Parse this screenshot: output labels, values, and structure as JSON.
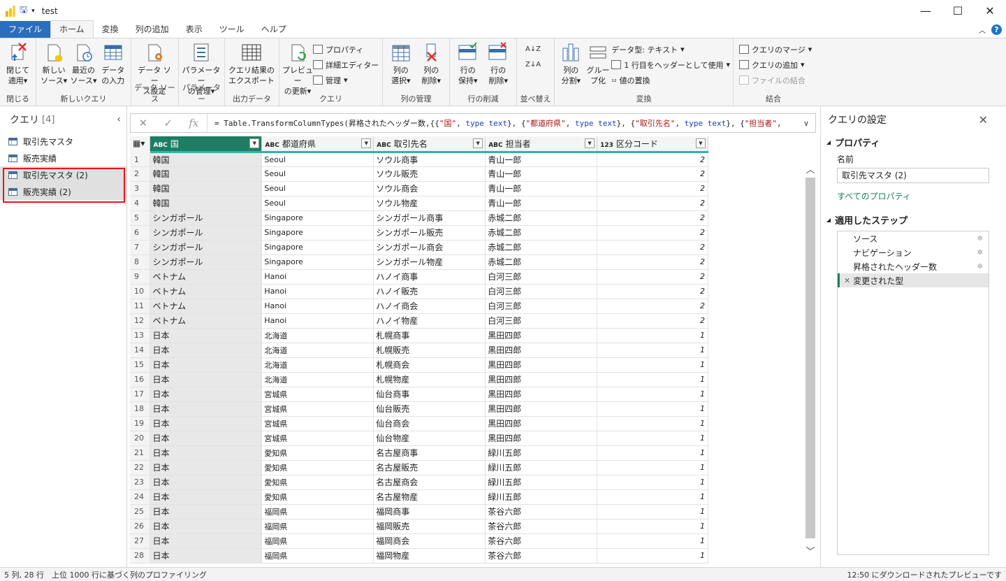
{
  "window": {
    "title": "test",
    "controls": [
      "minimize",
      "maximize",
      "close"
    ]
  },
  "tabs": [
    {
      "label": "ファイル",
      "kind": "file"
    },
    {
      "label": "ホーム",
      "kind": "active"
    },
    {
      "label": "変換",
      "kind": ""
    },
    {
      "label": "列の追加",
      "kind": ""
    },
    {
      "label": "表示",
      "kind": ""
    },
    {
      "label": "ツール",
      "kind": ""
    },
    {
      "label": "ヘルプ",
      "kind": ""
    }
  ],
  "ribbon": {
    "close": {
      "btn1": "閉じて",
      "btn2": "適用",
      "group": "閉じる"
    },
    "newquery": {
      "new1": "新しい",
      "new2": "ソース",
      "recent1": "最近の",
      "recent2": "ソース",
      "enter1": "データ",
      "enter2": "の入力",
      "group": "新しいクエリ"
    },
    "datasource": {
      "b1": "データ ソー",
      "b2": "ス設定",
      "group": "データ ソース"
    },
    "params": {
      "b1": "パラメーター",
      "b2": "の管理",
      "group": "パラメーター"
    },
    "export": {
      "b1": "クエリ結果の",
      "b2": "エクスポート",
      "group": "出力データ"
    },
    "query": {
      "refresh1": "プレビュー",
      "refresh2": "の更新",
      "props": "プロパティ",
      "editor": "詳細エディター",
      "manage": "管理",
      "group": "クエリ"
    },
    "cols": {
      "choose1": "列の",
      "choose2": "選択",
      "remove1": "列の",
      "remove2": "削除",
      "group": "列の管理"
    },
    "rows": {
      "keep1": "行の",
      "keep2": "保持",
      "remove1": "行の",
      "remove2": "削除",
      "group": "行の削減"
    },
    "sort": {
      "group": "並べ替え"
    },
    "transform": {
      "split1": "列の",
      "split2": "分割",
      "group1": "グルー",
      "group2": "プ化",
      "datatype": "データ型: テキスト",
      "header": "1 行目をヘッダーとして使用",
      "replace": "値の置換",
      "group": "変換"
    },
    "combine": {
      "merge": "クエリのマージ",
      "append": "クエリの追加",
      "files": "ファイルの結合",
      "group": "結合"
    }
  },
  "queries": {
    "title": "クエリ",
    "count": "[4]",
    "items": [
      {
        "label": "取引先マスタ",
        "selected": false
      },
      {
        "label": "販売実績",
        "selected": false
      },
      {
        "label": "取引先マスタ (2)",
        "selected": true
      },
      {
        "label": "販売実績 (2)",
        "selected": true
      }
    ]
  },
  "formula": {
    "prefix": "= Table.TransformColumnTypes(昇格されたヘッダー数,{{",
    "s1": "\"国\"",
    "t1": "type text",
    "s2": "\"都道府県\"",
    "t2": "type text",
    "s3": "\"取引先名\"",
    "t3": "type text",
    "s4": "\"担当者\""
  },
  "columns": [
    {
      "type": "ABC",
      "name": "国"
    },
    {
      "type": "ABC",
      "name": "都道府県"
    },
    {
      "type": "ABC",
      "name": "取引先名"
    },
    {
      "type": "ABC",
      "name": "担当者"
    },
    {
      "type": "123",
      "name": "区分コード"
    }
  ],
  "rows": [
    [
      "1",
      "韓国",
      "Seoul",
      "ソウル商事",
      "青山一郎",
      "2"
    ],
    [
      "2",
      "韓国",
      "Seoul",
      "ソウル販売",
      "青山一郎",
      "2"
    ],
    [
      "3",
      "韓国",
      "Seoul",
      "ソウル商会",
      "青山一郎",
      "2"
    ],
    [
      "4",
      "韓国",
      "Seoul",
      "ソウル物産",
      "青山一郎",
      "2"
    ],
    [
      "5",
      "シンガポール",
      "Singapore",
      "シンガポール商事",
      "赤城二郎",
      "2"
    ],
    [
      "6",
      "シンガポール",
      "Singapore",
      "シンガポール販売",
      "赤城二郎",
      "2"
    ],
    [
      "7",
      "シンガポール",
      "Singapore",
      "シンガポール商会",
      "赤城二郎",
      "2"
    ],
    [
      "8",
      "シンガポール",
      "Singapore",
      "シンガポール物産",
      "赤城二郎",
      "2"
    ],
    [
      "9",
      "ベトナム",
      "Hanoi",
      "ハノイ商事",
      "白河三郎",
      "2"
    ],
    [
      "10",
      "ベトナム",
      "Hanoi",
      "ハノイ販売",
      "白河三郎",
      "2"
    ],
    [
      "11",
      "ベトナム",
      "Hanoi",
      "ハノイ商会",
      "白河三郎",
      "2"
    ],
    [
      "12",
      "ベトナム",
      "Hanoi",
      "ハノイ物産",
      "白河三郎",
      "2"
    ],
    [
      "13",
      "日本",
      "北海道",
      "札幌商事",
      "黒田四郎",
      "1"
    ],
    [
      "14",
      "日本",
      "北海道",
      "札幌販売",
      "黒田四郎",
      "1"
    ],
    [
      "15",
      "日本",
      "北海道",
      "札幌商会",
      "黒田四郎",
      "1"
    ],
    [
      "16",
      "日本",
      "北海道",
      "札幌物産",
      "黒田四郎",
      "1"
    ],
    [
      "17",
      "日本",
      "宮城県",
      "仙台商事",
      "黒田四郎",
      "1"
    ],
    [
      "18",
      "日本",
      "宮城県",
      "仙台販売",
      "黒田四郎",
      "1"
    ],
    [
      "19",
      "日本",
      "宮城県",
      "仙台商会",
      "黒田四郎",
      "1"
    ],
    [
      "20",
      "日本",
      "宮城県",
      "仙台物産",
      "黒田四郎",
      "1"
    ],
    [
      "21",
      "日本",
      "愛知県",
      "名古屋商事",
      "緑川五郎",
      "1"
    ],
    [
      "22",
      "日本",
      "愛知県",
      "名古屋販売",
      "緑川五郎",
      "1"
    ],
    [
      "23",
      "日本",
      "愛知県",
      "名古屋商会",
      "緑川五郎",
      "1"
    ],
    [
      "24",
      "日本",
      "愛知県",
      "名古屋物産",
      "緑川五郎",
      "1"
    ],
    [
      "25",
      "日本",
      "福岡県",
      "福岡商事",
      "茶谷六郎",
      "1"
    ],
    [
      "26",
      "日本",
      "福岡県",
      "福岡販売",
      "茶谷六郎",
      "1"
    ],
    [
      "27",
      "日本",
      "福岡県",
      "福岡商会",
      "茶谷六郎",
      "1"
    ],
    [
      "28",
      "日本",
      "福岡県",
      "福岡物産",
      "茶谷六郎",
      "1"
    ]
  ],
  "settings": {
    "title": "クエリの設定",
    "props_section": "プロパティ",
    "name_label": "名前",
    "name_value": "取引先マスタ (2)",
    "all_props": "すべてのプロパティ",
    "steps_section": "適用したステップ",
    "steps": [
      {
        "label": "ソース",
        "gear": true,
        "selected": false
      },
      {
        "label": "ナビゲーション",
        "gear": true,
        "selected": false
      },
      {
        "label": "昇格されたヘッダー数",
        "gear": true,
        "selected": false
      },
      {
        "label": "変更された型",
        "gear": false,
        "selected": true
      }
    ]
  },
  "status": {
    "left": "5 列, 28 行　上位 1000 行に基づく列のプロファイリング",
    "right": "12:50 にダウンロードされたプレビューです"
  },
  "colors": {
    "accent": "#1e7d62",
    "teal": "#2bb7a8",
    "file_tab": "#2b6dbf",
    "highlight": "#e01818"
  }
}
